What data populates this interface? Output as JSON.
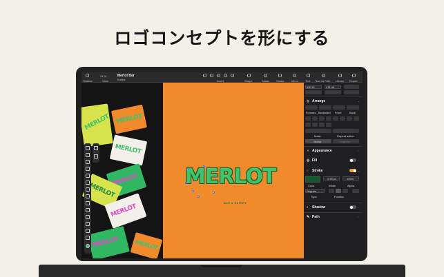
{
  "headline": "ロゴコンセプトを形にする",
  "toolbar": {
    "zoom": "31 %",
    "doc_title": "Merlot Bar",
    "doc_subtitle": "Edited",
    "left_label": "Sidebar",
    "view_label": "View",
    "items": [
      "Insert",
      "Shape",
      "Mask",
      "Stroke",
      "Mirror",
      "Text",
      "Text on Path",
      "Library",
      "Export"
    ]
  },
  "artboard": {
    "logo_text": "MERLOT",
    "sub_text": "BAR & EATERY",
    "background_color": "#f08a2a",
    "logo_color": "#3fc46e"
  },
  "cards": [
    {
      "text": "MERLOT",
      "bg": "#d6e34a"
    },
    {
      "text": "MERLOT",
      "bg": "#f08a2a"
    },
    {
      "text": "MERLOT",
      "bg": "#f3efe9"
    },
    {
      "text": "MERLOT",
      "bg": "#2fb861"
    },
    {
      "text": "MERLOT",
      "bg": "#d6e34a"
    },
    {
      "text": "MERLOT",
      "bg": "#f3efe9"
    },
    {
      "text": "MERLOT",
      "bg": "#2fb861"
    },
    {
      "text": "MERLOT",
      "bg": "#f08a2a"
    }
  ],
  "panel": {
    "x_field": "630.11",
    "y_field": "471.46",
    "arrange_title": "Arrange",
    "arrange_buttons": [
      "Forward",
      "Backward",
      "Front",
      "Back"
    ],
    "mask_label": "Mask",
    "repeat_label": "Repeat action",
    "group_label": "Group",
    "ungroup_label": "Ungroup",
    "appearance_title": "Appearance",
    "fill_label": "Fill",
    "stroke_label": "Stroke",
    "stroke_color_label": "Color",
    "stroke_width_value": "2.93 pt",
    "stroke_width_label": "Width",
    "stroke_alpha_value": "100%",
    "stroke_alpha_label": "Alpha",
    "stroke_type_value": "Regular",
    "stroke_type_label": "Type",
    "stroke_position_label": "Position",
    "shadow_title": "Shadow",
    "path_title": "Path"
  }
}
